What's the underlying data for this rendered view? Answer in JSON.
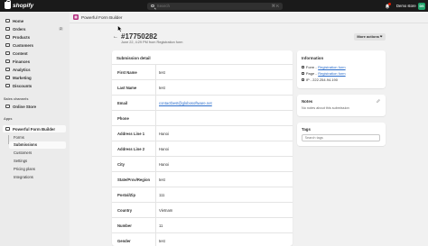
{
  "topbar": {
    "brand": "shopify",
    "search_placeholder": "Search",
    "search_shortcut": "⌘ K",
    "store_name": "Demo store",
    "avatar_initials": "DS"
  },
  "sidebar": {
    "items": [
      {
        "label": "Home"
      },
      {
        "label": "Orders",
        "badge": "2"
      },
      {
        "label": "Products"
      },
      {
        "label": "Customers"
      },
      {
        "label": "Content"
      },
      {
        "label": "Finances"
      },
      {
        "label": "Analytics"
      },
      {
        "label": "Marketing"
      },
      {
        "label": "Discounts"
      }
    ],
    "sales_channels_heading": "Sales channels",
    "online_store": "Online Store",
    "apps_heading": "Apps",
    "app_name": "Powerful Form Builder",
    "app_sub_items": [
      "Forms",
      "Submissions",
      "Customers",
      "Settings",
      "Pricing plans",
      "Integrations"
    ]
  },
  "app_header": {
    "title": "Powerful Form Builder"
  },
  "page": {
    "title": "#17750282",
    "subtitle": "June 22, 4:29 PM from Registration form",
    "more_actions": "More actions"
  },
  "submission": {
    "heading": "Submission detail",
    "rows": [
      {
        "label": "First Name",
        "value": "test"
      },
      {
        "label": "Last Name",
        "value": "test"
      },
      {
        "label": "Email",
        "value": "contactbest@globosoftware.net",
        "link": true
      },
      {
        "label": "Phone",
        "value": ""
      },
      {
        "label": "Address Line 1",
        "value": "Hanoi"
      },
      {
        "label": "Address Line 2",
        "value": "Hanoi"
      },
      {
        "label": "City",
        "value": "Hanoi"
      },
      {
        "label": "State/Prov/Region",
        "value": "test"
      },
      {
        "label": "Postal/Zip",
        "value": "111"
      },
      {
        "label": "Country",
        "value": "Vietnam"
      },
      {
        "label": "Number",
        "value": "11"
      },
      {
        "label": "Gender",
        "value": "test"
      }
    ]
  },
  "information": {
    "heading": "Information",
    "form_label": "Form - ",
    "form_link": "Registration form",
    "page_label": "Page - ",
    "page_link": "Registration form",
    "ip": "IP - 222.254.94.190"
  },
  "notes": {
    "heading": "Notes",
    "text": "No notes about this submission"
  },
  "tags": {
    "heading": "Tags",
    "placeholder": "Search tags"
  },
  "colors": {
    "topbar": "#1a1a1a",
    "link": "#2c6ecb",
    "app_icon": "#b32d7e",
    "avatar": "#22a36b",
    "notification": "#e51c00"
  }
}
